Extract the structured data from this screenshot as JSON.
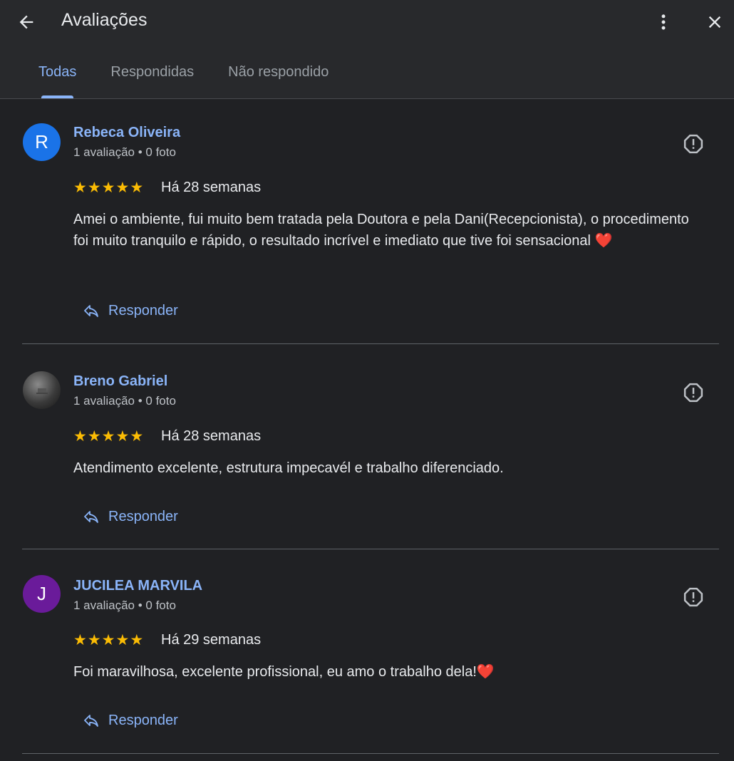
{
  "header": {
    "title": "Avaliações"
  },
  "tabs": [
    {
      "label": "Todas",
      "active": true
    },
    {
      "label": "Respondidas",
      "active": false
    },
    {
      "label": "Não respondido",
      "active": false
    }
  ],
  "reviews": [
    {
      "avatar_letter": "R",
      "avatar_color": "#1a73e8",
      "name": "Rebeca Oliveira",
      "meta": "1 avaliação • 0 foto",
      "rating": 5,
      "stars": "★★★★★",
      "time": "Há 28 semanas",
      "text": "Amei o ambiente, fui muito bem tratada pela Doutora e pela Dani(Recepcionista), o procedimento foi muito tranquilo e rápido, o resultado incrível e imediato que tive foi sensacional ❤️",
      "reply_label": "Responder"
    },
    {
      "avatar_letter": "",
      "avatar_color": "#3c3c3c",
      "name": "Breno Gabriel",
      "meta": "1 avaliação • 0 foto",
      "rating": 5,
      "stars": "★★★★★",
      "time": "Há 28 semanas",
      "text": "Atendimento excelente, estrutura impecavél e trabalho diferenciado.",
      "reply_label": "Responder"
    },
    {
      "avatar_letter": "J",
      "avatar_color": "#6a1b9a",
      "name": "JUCILEA MARVILA",
      "meta": "1 avaliação • 0 foto",
      "rating": 5,
      "stars": "★★★★★",
      "time": "Há 29 semanas",
      "text": "Foi maravilhosa, excelente profissional, eu amo o trabalho dela!❤️",
      "reply_label": "Responder"
    }
  ],
  "colors": {
    "background": "#202124",
    "accent": "#8ab4f8",
    "star": "#fbbc04"
  }
}
